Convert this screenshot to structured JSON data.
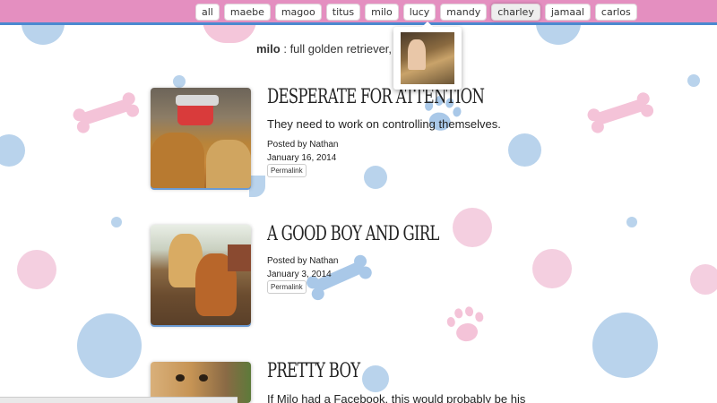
{
  "nav": {
    "tags": [
      "all",
      "maebe",
      "magoo",
      "titus",
      "milo",
      "lucy",
      "mandy",
      "charley",
      "jamaal",
      "carlos"
    ],
    "active": "charley"
  },
  "intro": {
    "name": "milo",
    "text": " : full golden retriever, ab"
  },
  "posts": [
    {
      "title": "DESPERATE FOR ATTENTION",
      "body": "They need to work on controlling themselves.",
      "posted_by": "Posted by Nathan",
      "date": "January 16, 2014",
      "permalink": "Permalink"
    },
    {
      "title": "A GOOD BOY AND GIRL",
      "body": "",
      "posted_by": "Posted by Nathan",
      "date": "January 3, 2014",
      "permalink": "Permalink"
    },
    {
      "title": "PRETTY BOY",
      "body": "If Milo had a Facebook, this would probably be his",
      "posted_by": "",
      "date": "",
      "permalink": ""
    }
  ],
  "colors": {
    "topbar": "#e48fc0",
    "topbar_border": "#4b89d0",
    "blue_dot": "#b9d3ec",
    "pink_dot": "#f4cfe0"
  }
}
